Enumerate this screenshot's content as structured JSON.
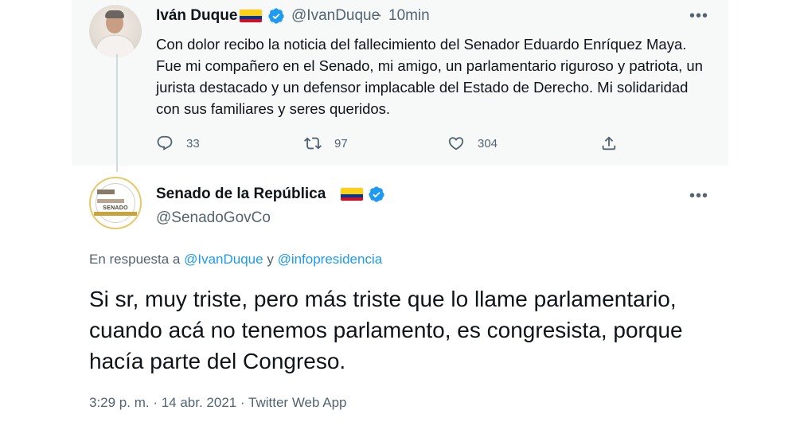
{
  "original_tweet": {
    "author_name": "Iván Duque",
    "handle": "@IvanDuque",
    "separator": "·",
    "time": "10min",
    "text": "Con dolor recibo la noticia del fallecimiento del Senador Eduardo Enríquez Maya. Fue mi compañero en el Senado, mi amigo, un parlamentario riguroso y patriota, un jurista destacado y un defensor implacable del Estado de Derecho. Mi solidaridad con sus familiares y seres queridos.",
    "replies": "33",
    "retweets": "97",
    "likes": "304"
  },
  "reply_tweet": {
    "author_name": "Senado de la República",
    "handle": "@SenadoGovCo",
    "avatar_text": "SENADO",
    "replying_prefix": "En respuesta a",
    "replying_user_1": "@IvanDuque",
    "replying_conjunction": "y",
    "replying_user_2": "@infopresidencia",
    "text": "Si sr, muy triste, pero más triste que lo llame parlamentario, cuando acá no tenemos parlamento, es congresista, porque hacía parte del Congreso.",
    "meta": "3:29 p. m. · 14 abr. 2021 · Twitter Web App"
  },
  "icons": {
    "verified": "verified-badge-icon",
    "flag": "colombia-flag-icon",
    "reply": "reply-icon",
    "retweet": "retweet-icon",
    "like": "heart-icon",
    "share": "share-icon",
    "more": "more-options-icon"
  },
  "colors": {
    "accent": "#1d9bf0",
    "muted_text": "#536471",
    "parent_background": "#f7f9f9",
    "thread_line": "#cfd9de"
  }
}
